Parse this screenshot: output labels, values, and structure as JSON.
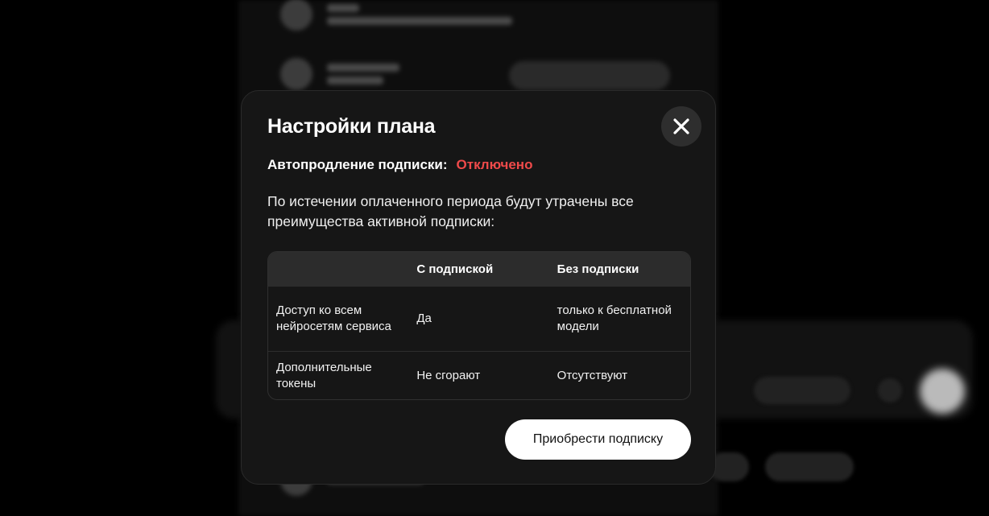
{
  "modal": {
    "title": "Настройки плана",
    "close_icon": "close-icon",
    "autorenew": {
      "label": "Автопродление подписки:",
      "status": "Отключено",
      "status_color": "#ef4a4a"
    },
    "description": "По истечении оплаченного периода будут утрачены все преимущества активной подписки:",
    "table": {
      "headers": [
        "",
        "С подпиской",
        "Без подписки"
      ],
      "rows": [
        [
          "Доступ ко всем нейросетям сервиса",
          "Да",
          "только к бесплатной модели"
        ],
        [
          "Дополнительные токены",
          "Не сгорают",
          "Отсутствуют"
        ]
      ]
    },
    "buy_label": "Приобрести подписку"
  },
  "colors": {
    "page_bg": "#000000",
    "modal_bg": "#161616",
    "table_header_bg": "#2c2c2c",
    "primary_button_bg": "#ffffff",
    "danger": "#ef4a4a"
  }
}
